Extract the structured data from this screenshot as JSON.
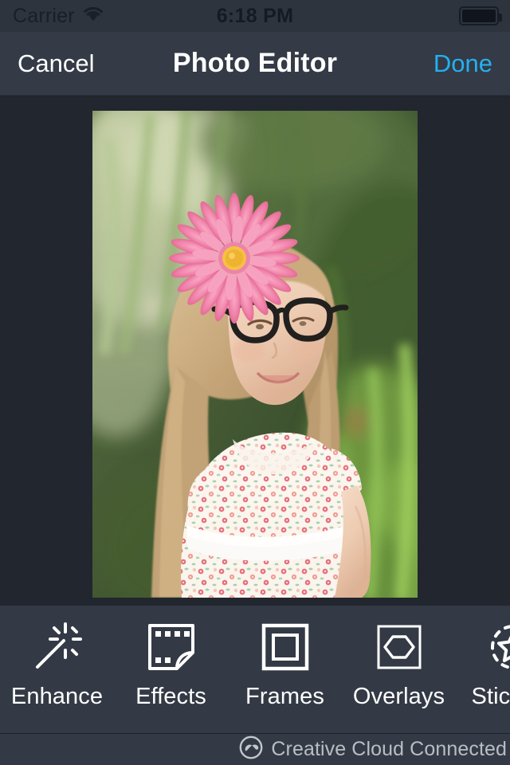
{
  "status_bar": {
    "carrier": "Carrier",
    "wifi_icon": "wifi-icon",
    "time": "6:18 PM",
    "battery_icon": "battery-icon"
  },
  "nav_bar": {
    "cancel_label": "Cancel",
    "title": "Photo Editor",
    "done_label": "Done",
    "done_color": "#25b0f0"
  },
  "canvas": {
    "photo_alt": "Young girl with pink gerbera daisy hair clip and black glasses sticker overlay, blurred green garden background",
    "photo_width": 408,
    "photo_height": 611
  },
  "toolbar": {
    "items": [
      {
        "label": "Enhance",
        "icon": "magic-wand-icon"
      },
      {
        "label": "Effects",
        "icon": "film-frame-icon"
      },
      {
        "label": "Frames",
        "icon": "nested-square-icon"
      },
      {
        "label": "Overlays",
        "icon": "hexagon-in-square-icon"
      },
      {
        "label": "Stickers",
        "icon": "dashed-circle-star-icon"
      }
    ]
  },
  "footer": {
    "badge_icon": "creative-cloud-icon",
    "badge_text": "Creative Cloud Connected",
    "text_color": "#b9bdc4"
  }
}
